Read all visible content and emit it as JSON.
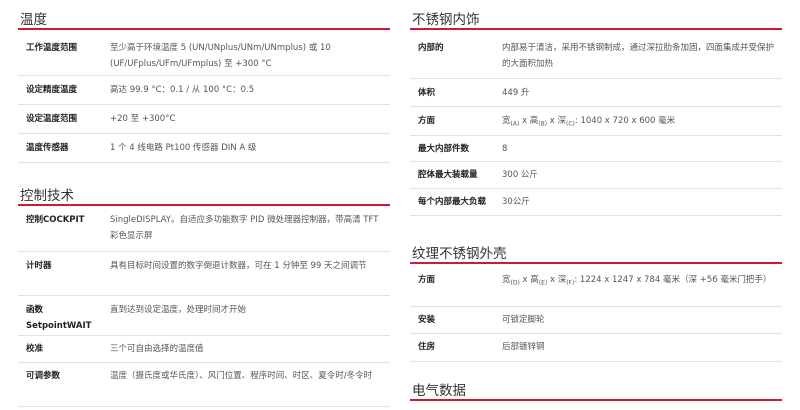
{
  "left": {
    "sections": [
      {
        "title": "温度",
        "rows": [
          {
            "key": "工作温度范围",
            "value": "至少高于环境温度 5 (UN/UNplus/UNm/UNmplus) 或 10 (UF/UFplus/UFm/UFmplus) 至 +300 °C"
          },
          {
            "key": "设定精度温度",
            "value": "高达 99.9 °C：0.1 / 从 100 °C：0.5"
          },
          {
            "key": "设定温度范围",
            "value": "+20 至 +300°C"
          },
          {
            "key": "温度传感器",
            "value": "1 个 4 线电路 Pt100 传感器 DIN A 级"
          }
        ]
      },
      {
        "title": "控制技术",
        "rows": [
          {
            "key": "控制COCKPIT",
            "value": "SingleDISPLAY。自适应多功能数字 PID 微处理器控制器，带高清 TFT 彩色显示屏"
          },
          {
            "key": "计时器",
            "value": "具有目标时间设置的数字倒退计数器，可在 1 分钟至 99 天之间调节"
          },
          {
            "key": "函数 SetpointWAIT",
            "value": "直到达到设定温度，处理时间才开始"
          },
          {
            "key": "校准",
            "value": "三个可自由选择的温度值"
          },
          {
            "key": "可调参数",
            "value": "温度（摄氏度或华氏度）、风门位置、程序时间、时区、夏令时/冬令时"
          }
        ]
      }
    ]
  },
  "right": {
    "sections": [
      {
        "title": "不锈钢内饰",
        "rows": [
          {
            "key": "内部的",
            "value": "内部易于清洁，采用不锈钢制成，通过深拉肋条加固，四面集成并受保护的大面积加热"
          },
          {
            "key": "体积",
            "value": "449 升"
          },
          {
            "key": "方面",
            "value": "",
            "dims": {
              "w": "宽",
              "w_sub": "(A)",
              "h": "高",
              "h_sub": "(B)",
              "d": "深",
              "d_sub": "(C)",
              "rest": ": 1040 x 720 x 600 毫米"
            }
          },
          {
            "key": "最大内部件数",
            "value": "8"
          },
          {
            "key": "腔体最大装载量",
            "value": "300 公斤"
          },
          {
            "key": "每个内部最大负载",
            "value": "30公斤"
          }
        ]
      },
      {
        "title": "纹理不锈钢外壳",
        "rows": [
          {
            "key": "方面",
            "value": "",
            "dims": {
              "w": "宽",
              "w_sub": "(D)",
              "h": "高",
              "h_sub": "(E)",
              "d": "深",
              "d_sub": "(F)",
              "rest": ": 1224 x 1247 x 784 毫米（深 +56 毫米门把手）"
            }
          },
          {
            "key": "安装",
            "value": "可锁定脚轮"
          },
          {
            "key": "住房",
            "value": "后部镀锌钢"
          }
        ]
      },
      {
        "title": "电气数据",
        "rows": []
      }
    ]
  },
  "colors": {
    "accent": "#cc1d2e",
    "divider": "#e2e2e2"
  }
}
